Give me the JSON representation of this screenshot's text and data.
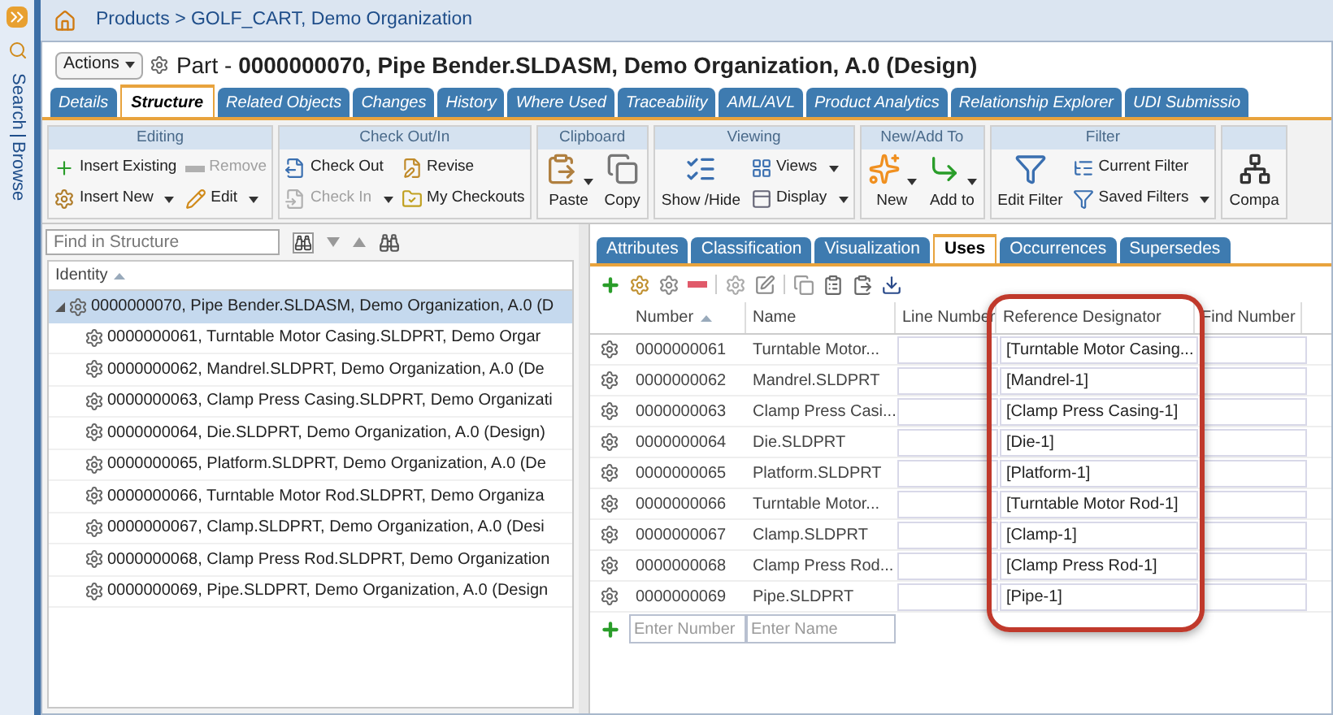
{
  "side_strip": {
    "labels": [
      "Search",
      "Browse"
    ]
  },
  "breadcrumb": "Products > GOLF_CART, Demo Organization",
  "actions_button": "Actions",
  "title": {
    "prefix": "Part - ",
    "name": "0000000070, Pipe Bender.SLDASM, Demo Organization, A.0 (Design)"
  },
  "tabs": [
    {
      "label": "Details",
      "selected": false
    },
    {
      "label": "Structure",
      "selected": true
    },
    {
      "label": "Related Objects",
      "selected": false
    },
    {
      "label": "Changes",
      "selected": false
    },
    {
      "label": "History",
      "selected": false
    },
    {
      "label": "Where Used",
      "selected": false
    },
    {
      "label": "Traceability",
      "selected": false
    },
    {
      "label": "AML/AVL",
      "selected": false
    },
    {
      "label": "Product Analytics",
      "selected": false
    },
    {
      "label": "Relationship Explorer",
      "selected": false
    },
    {
      "label": "UDI Submissio",
      "selected": false
    }
  ],
  "ribbon": [
    {
      "title": "Editing",
      "items": [
        {
          "label": "Insert Existing",
          "kind": "small",
          "disabled": false,
          "dropdown": false
        },
        {
          "label": "Insert New",
          "kind": "small",
          "disabled": false,
          "dropdown": true
        },
        {
          "label": "Remove",
          "kind": "small",
          "disabled": true,
          "dropdown": false
        },
        {
          "label": "Edit",
          "kind": "small",
          "disabled": false,
          "dropdown": true
        }
      ]
    },
    {
      "title": "Check Out/In",
      "items": [
        {
          "label": "Check Out",
          "kind": "small",
          "disabled": false,
          "dropdown": false
        },
        {
          "label": "Check In",
          "kind": "small",
          "disabled": true,
          "dropdown": true
        },
        {
          "label": "Revise",
          "kind": "small",
          "disabled": false,
          "dropdown": false
        },
        {
          "label": "My Checkouts",
          "kind": "small",
          "disabled": false,
          "dropdown": false
        }
      ]
    },
    {
      "title": "Clipboard",
      "items": [
        {
          "label": "Paste",
          "kind": "large",
          "disabled": false,
          "dropdown": true
        },
        {
          "label": "Copy",
          "kind": "large",
          "disabled": false,
          "dropdown": false
        }
      ]
    },
    {
      "title": "Viewing",
      "items": [
        {
          "label": "Show /Hide",
          "kind": "large",
          "disabled": false,
          "dropdown": false
        },
        {
          "label": "Views",
          "kind": "small",
          "disabled": false,
          "dropdown": true
        },
        {
          "label": "Display",
          "kind": "small",
          "disabled": false,
          "dropdown": true
        }
      ]
    },
    {
      "title": "New/Add To",
      "items": [
        {
          "label": "New",
          "kind": "large",
          "disabled": false,
          "dropdown": true
        },
        {
          "label": "Add to",
          "kind": "large",
          "disabled": false,
          "dropdown": true
        }
      ]
    },
    {
      "title": "Filter",
      "items": [
        {
          "label": "Edit Filter",
          "kind": "large",
          "disabled": false,
          "dropdown": false
        },
        {
          "label": "Current Filter",
          "kind": "small",
          "disabled": false,
          "dropdown": false
        },
        {
          "label": "Saved Filters",
          "kind": "small",
          "disabled": false,
          "dropdown": true
        }
      ]
    },
    {
      "items": [
        {
          "label": "Compa",
          "kind": "large",
          "disabled": false,
          "dropdown": false
        }
      ]
    }
  ],
  "find": {
    "placeholder": "Find in Structure"
  },
  "tree": {
    "column": "Identity",
    "sorted": true,
    "items": [
      {
        "label": "0000000070, Pipe Bender.SLDASM, Demo Organization, A.0 (D",
        "selected": true,
        "expanded": true,
        "children": [
          {
            "label": "0000000061, Turntable Motor Casing.SLDPRT, Demo Orgar",
            "selected": false
          },
          {
            "label": "0000000062, Mandrel.SLDPRT, Demo Organization, A.0 (De",
            "selected": false
          },
          {
            "label": "0000000063, Clamp Press Casing.SLDPRT, Demo Organizati",
            "selected": false
          },
          {
            "label": "0000000064, Die.SLDPRT, Demo Organization, A.0 (Design)",
            "selected": false
          },
          {
            "label": "0000000065, Platform.SLDPRT, Demo Organization, A.0 (De",
            "selected": false
          },
          {
            "label": "0000000066, Turntable Motor Rod.SLDPRT, Demo Organiza",
            "selected": false
          },
          {
            "label": "0000000067, Clamp.SLDPRT, Demo Organization, A.0 (Desi",
            "selected": false
          },
          {
            "label": "0000000068, Clamp Press Rod.SLDPRT, Demo Organization",
            "selected": false
          },
          {
            "label": "0000000069, Pipe.SLDPRT, Demo Organization, A.0 (Design",
            "selected": false
          }
        ]
      }
    ]
  },
  "sub_tabs": [
    {
      "label": "Attributes",
      "selected": false
    },
    {
      "label": "Classification",
      "selected": false
    },
    {
      "label": "Visualization",
      "selected": false
    },
    {
      "label": "Uses",
      "selected": true
    },
    {
      "label": "Occurrences",
      "selected": false
    },
    {
      "label": "Supersedes",
      "selected": false
    }
  ],
  "uses_table": {
    "columns": [
      {
        "label": "Number",
        "sorted": true
      },
      {
        "label": "Name",
        "sorted": false
      },
      {
        "label": "Line Number",
        "sorted": false
      },
      {
        "label": "Reference Designator",
        "sorted": false
      },
      {
        "label": "Find Number",
        "sorted": false
      }
    ],
    "rows": [
      {
        "number": "0000000061",
        "name": "Turntable Motor...",
        "reference_designator": "[Turntable Motor Casing..."
      },
      {
        "number": "0000000062",
        "name": "Mandrel.SLDPRT",
        "reference_designator": "[Mandrel-1]"
      },
      {
        "number": "0000000063",
        "name": "Clamp Press Casi...",
        "reference_designator": "[Clamp Press Casing-1]"
      },
      {
        "number": "0000000064",
        "name": "Die.SLDPRT",
        "reference_designator": "[Die-1]"
      },
      {
        "number": "0000000065",
        "name": "Platform.SLDPRT",
        "reference_designator": "[Platform-1]"
      },
      {
        "number": "0000000066",
        "name": "Turntable Motor...",
        "reference_designator": "[Turntable Motor Rod-1]"
      },
      {
        "number": "0000000067",
        "name": "Clamp.SLDPRT",
        "reference_designator": "[Clamp-1]"
      },
      {
        "number": "0000000068",
        "name": "Clamp Press Rod...",
        "reference_designator": "[Clamp Press Rod-1]"
      },
      {
        "number": "0000000069",
        "name": "Pipe.SLDPRT",
        "reference_designator": "[Pipe-1]"
      }
    ],
    "new_row": {
      "number_placeholder": "Enter Number",
      "name_placeholder": "Enter Name"
    }
  }
}
